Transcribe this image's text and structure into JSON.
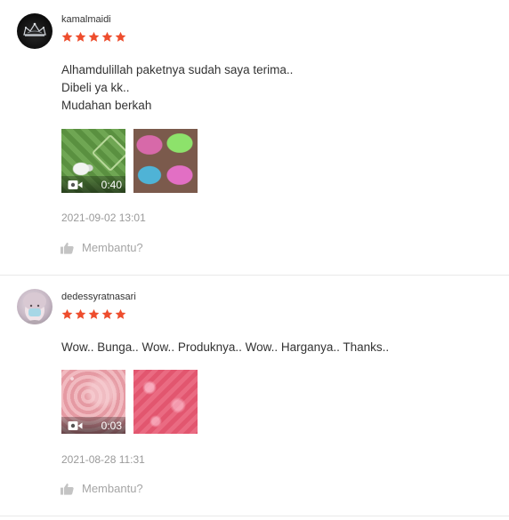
{
  "rating_color": "#ee4d2d",
  "helpful_label": "Membantu?",
  "reviews": [
    {
      "username": "kamalmaidi",
      "stars": 5,
      "comment_lines": [
        "Alhamdulillah paketnya sudah saya terima..",
        "Dibeli ya kk..",
        "Mudahan berkah"
      ],
      "video_duration": "0:40",
      "date": "2021-09-02 13:01"
    },
    {
      "username": "dedessyratnasari",
      "stars": 5,
      "comment_lines": [
        "Wow.. Bunga.. Wow.. Produknya.. Wow.. Harganya.. Thanks.."
      ],
      "video_duration": "0:03",
      "date": "2021-08-28 11:31"
    }
  ]
}
